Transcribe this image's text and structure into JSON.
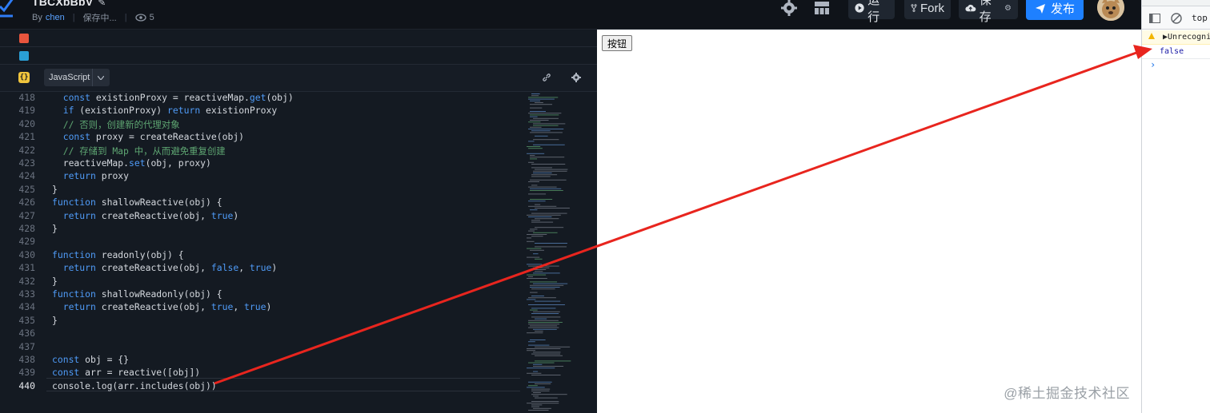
{
  "header": {
    "project_title": "TBCXbBbV",
    "by_label": "By",
    "author": "chen",
    "save_status": "保存中...",
    "views": "5",
    "run_label": "运行",
    "fork_label": "Fork",
    "save_label": "保存",
    "publish_label": "发布"
  },
  "editor": {
    "language": "JavaScript",
    "lang_badge": "{}",
    "lines": [
      {
        "n": "418",
        "html": "  <span class='kw'>const</span> existionProxy = reactiveMap.<span class='fn'>get</span>(obj)"
      },
      {
        "n": "419",
        "html": "  <span class='kw'>if</span> (existionProxy) <span class='kw'>return</span> existionProxy"
      },
      {
        "n": "420",
        "html": "  <span class='cm'>// 否则，创建新的代理对象</span>"
      },
      {
        "n": "421",
        "html": "  <span class='kw'>const</span> proxy = createReactive(obj)"
      },
      {
        "n": "422",
        "html": "  <span class='cm'>// 存储到 Map 中，从而避免重复创建</span>"
      },
      {
        "n": "423",
        "html": "  reactiveMap.<span class='fn'>set</span>(obj, proxy)"
      },
      {
        "n": "424",
        "html": "  <span class='kw'>return</span> proxy"
      },
      {
        "n": "425",
        "html": "}"
      },
      {
        "n": "426",
        "html": "<span class='kw'>function</span> shallowReactive(obj) {"
      },
      {
        "n": "427",
        "html": "  <span class='kw'>return</span> createReactive(obj, <span class='bool'>true</span>)"
      },
      {
        "n": "428",
        "html": "}"
      },
      {
        "n": "429",
        "html": ""
      },
      {
        "n": "430",
        "html": "<span class='kw'>function</span> readonly(obj) {"
      },
      {
        "n": "431",
        "html": "  <span class='kw'>return</span> createReactive(obj, <span class='bool'>false</span>, <span class='bool'>true</span>)"
      },
      {
        "n": "432",
        "html": "}"
      },
      {
        "n": "433",
        "html": "<span class='kw'>function</span> shallowReadonly(obj) {"
      },
      {
        "n": "434",
        "html": "  <span class='kw'>return</span> createReactive(obj, <span class='bool'>true</span>, <span class='bool'>true</span>)"
      },
      {
        "n": "435",
        "html": "}"
      },
      {
        "n": "436",
        "html": ""
      },
      {
        "n": "437",
        "html": ""
      },
      {
        "n": "438",
        "html": "<span class='kw'>const</span> obj = {}"
      },
      {
        "n": "439",
        "html": "<span class='kw'>const</span> arr = reactive([obj])"
      },
      {
        "n": "440",
        "html": "console.log(arr.includes(obj))"
      }
    ],
    "active_line": "440"
  },
  "preview": {
    "button_label": "按钮",
    "watermark": "@稀土掘金技术社区"
  },
  "devtools": {
    "context": "top",
    "warning_text": "▶Unrecogni",
    "log_value": "false",
    "prompt": "›"
  },
  "colors": {
    "accent": "#1e80ff",
    "arrow": "#e8251e",
    "editor_bg": "#141a22"
  }
}
